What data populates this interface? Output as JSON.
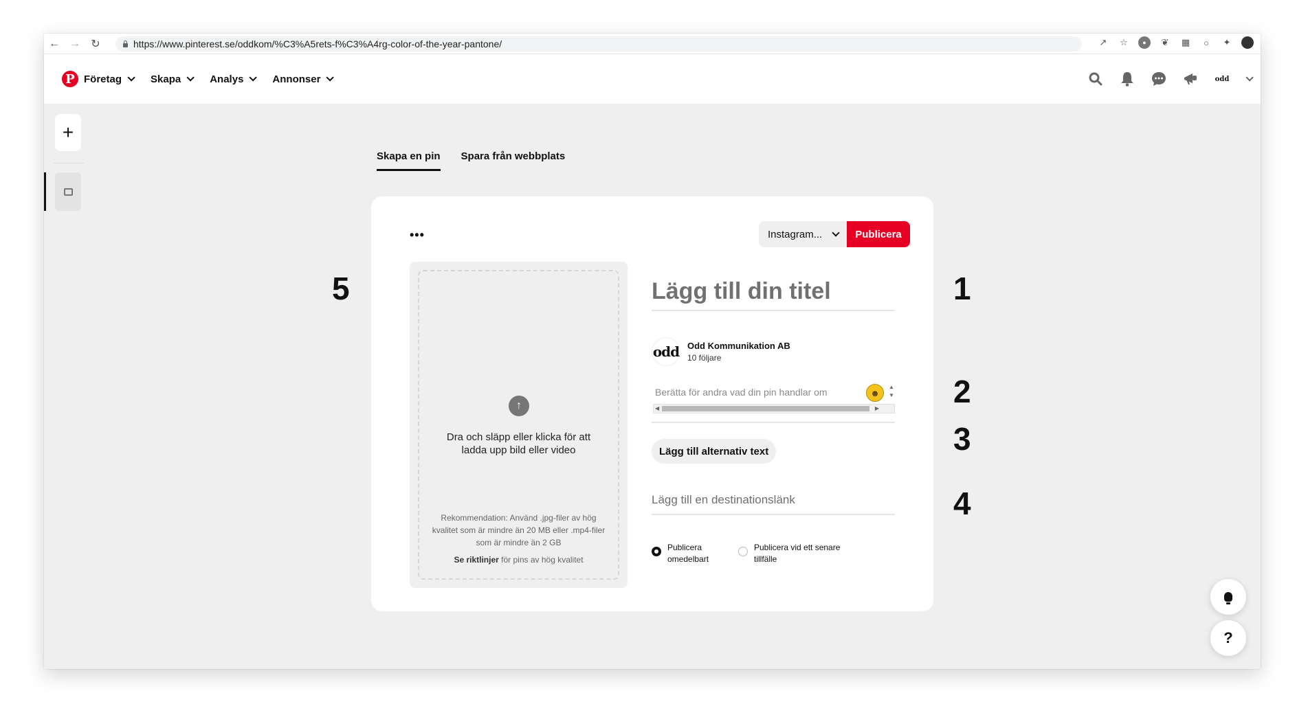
{
  "browser": {
    "url": "https://www.pinterest.se/oddkom/%C3%A5rets-f%C3%A4rg-color-of-the-year-pantone/",
    "nav_icons": [
      "back-arrow-icon",
      "forward-arrow-icon",
      "reload-icon"
    ],
    "extension_icons": [
      "share-icon",
      "star-icon",
      "extension-icon",
      "evernote-icon",
      "extension-icon",
      "extension-icon",
      "puzzle-icon",
      "profile-avatar-icon"
    ]
  },
  "topnav": {
    "logo": "P",
    "menu": [
      {
        "label": "Företag"
      },
      {
        "label": "Skapa"
      },
      {
        "label": "Analys"
      },
      {
        "label": "Annonser"
      }
    ],
    "right_icons": [
      "search-icon",
      "bell-icon",
      "chat-icon",
      "megaphone-icon"
    ],
    "account_logo": "odd"
  },
  "rail": {
    "plus": "+"
  },
  "tabs": [
    {
      "label": "Skapa en pin",
      "active": true
    },
    {
      "label": "Spara från webbplats",
      "active": false
    }
  ],
  "card": {
    "more": "•••",
    "board_select": "Instagram...",
    "publish_label": "Publicera",
    "upload": {
      "main_text": "Dra och släpp eller klicka för att ladda upp bild eller video",
      "recommendation": "Rekommendation: Använd .jpg-filer av hög kvalitet som är mindre än 20 MB eller .mp4-filer som är mindre än 2 GB",
      "guide_bold": "Se riktlinjer",
      "guide_rest": " för pins av hög kvalitet"
    },
    "title_placeholder": "Lägg till din titel",
    "profile": {
      "avatar_text": "odd",
      "name": "Odd Kommunikation AB",
      "followers": "10 följare"
    },
    "description_placeholder": "Berätta för andra vad din pin handlar om",
    "alt_text_button": "Lägg till alternativ text",
    "link_placeholder": "Lägg till en destinationslänk",
    "publish_options": [
      {
        "label": "Publicera omedelbart",
        "selected": true
      },
      {
        "label": "Publicera vid ett senare tillfälle",
        "selected": false
      }
    ]
  },
  "annotations": [
    "1",
    "2",
    "3",
    "4",
    "5"
  ],
  "floating": {
    "help": "?"
  },
  "colors": {
    "brand_red": "#e60023",
    "page_bg": "#efefef"
  }
}
